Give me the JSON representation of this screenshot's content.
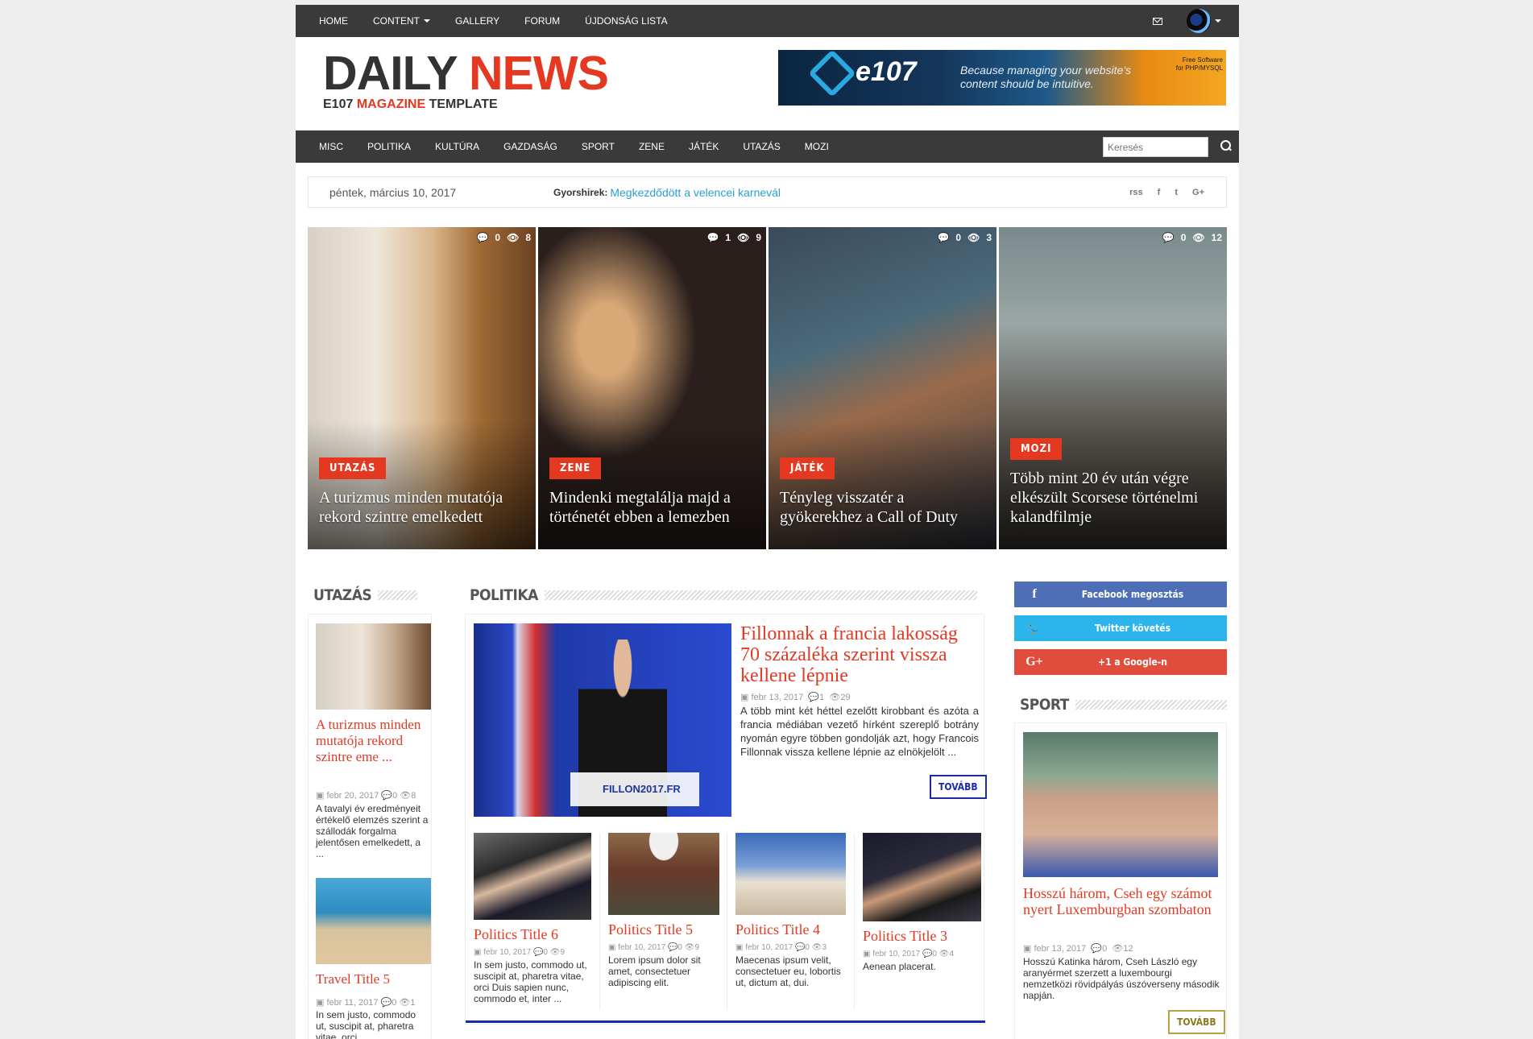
{
  "topnav": {
    "items": [
      "HOME",
      "CONTENT",
      "GALLERY",
      "FORUM",
      "ÚJDONSÁG LISTA"
    ]
  },
  "logo": {
    "word1": "DAILY",
    "word2": "NEWS",
    "sub1": "E107",
    "sub2": "MAGAZINE",
    "sub3": "TEMPLATE"
  },
  "banner": {
    "logo_text": "e107",
    "tagline1": "Because managing your website's",
    "tagline2": "content should be intuitive.",
    "fs1": "Free Software",
    "fs2": "for PHP/MYSQL"
  },
  "catnav": {
    "items": [
      "MISC",
      "POLITIKA",
      "KULTÚRA",
      "GAZDASÁG",
      "SPORT",
      "ZENE",
      "JÁTÉK",
      "UTAZÁS",
      "MOZI"
    ],
    "search_placeholder": "Keresés"
  },
  "infobar": {
    "date": "péntek, március 10, 2017",
    "breaking_label": "Gyorshirek:",
    "breaking_text": "Megkezdődött a velencei karnevál",
    "social": [
      "rss",
      "f",
      "t",
      "G+"
    ]
  },
  "featured": [
    {
      "badge": "UTAZÁS",
      "title": "A turizmus minden mutatója rekord szintre emelkedett",
      "comments": "0",
      "views": "8"
    },
    {
      "badge": "ZENE",
      "title": "Mindenki megtalálja majd a történetét ebben a lemezben",
      "comments": "1",
      "views": "9"
    },
    {
      "badge": "JÁTÉK",
      "title": "Tényleg visszatér a gyökerekhez a Call of Duty",
      "comments": "0",
      "views": "3"
    },
    {
      "badge": "MOZI",
      "title": "Több mint 20 év után végre elkészült Scorsese történelmi kalandfilmje",
      "comments": "0",
      "views": "12"
    }
  ],
  "utazas": {
    "heading": "UTAZÁS",
    "items": [
      {
        "title": "A turizmus minden mutatója rekord szintre eme ...",
        "date": "febr 20, 2017",
        "comments": "0",
        "views": "8",
        "excerpt": "A tavalyi év eredményeit értékelő elemzés szerint a szállodák forgalma jelentősen emelkedett, a ..."
      },
      {
        "title": "Travel Title 5",
        "date": "febr 11, 2017",
        "comments": "0",
        "views": "1",
        "excerpt": "In sem justo, commodo ut, suscipit at, pharetra vitae, orci."
      }
    ]
  },
  "politika": {
    "heading": "POLITIKA",
    "main": {
      "title": "Fillonnak a francia lakosság 70 százaléka szerint vissza kellene lépnie",
      "date": "febr 13, 2017",
      "comments": "1",
      "views": "29",
      "excerpt": "A több mint két héttel ezelőtt kirobbant és azóta a francia médiában vezető hírként szereplő botrány nyomán egyre többen gondolják azt, hogy Francois Fillonnak vissza kellene lépnie az elnökjelölt ...",
      "podium": "FILLON2017.FR",
      "more": "TOVÁBB"
    },
    "grid": [
      {
        "title": "Politics Title 6",
        "date": "febr 10, 2017",
        "comments": "0",
        "views": "9",
        "excerpt": "In sem justo, commodo ut, suscipit at, pharetra vitae, orci Duis sapien nunc, commodo et, inter ..."
      },
      {
        "title": "Politics Title 5",
        "date": "febr 10, 2017",
        "comments": "0",
        "views": "9",
        "excerpt": "Lorem ipsum dolor sit amet, consectetuer adipiscing elit."
      },
      {
        "title": "Politics Title 4",
        "date": "febr 10, 2017",
        "comments": "0",
        "views": "3",
        "excerpt": "Maecenas ipsum velit, consectetuer eu, lobortis ut, dictum at, dui."
      },
      {
        "title": "Politics Title 3",
        "date": "febr 10, 2017",
        "comments": "0",
        "views": "4",
        "excerpt": "Aenean placerat."
      }
    ]
  },
  "social_buttons": {
    "facebook": "Facebook megosztás",
    "twitter": "Twitter követés",
    "google": "+1 a Google-n"
  },
  "sport": {
    "heading": "SPORT",
    "title": "Hosszú három, Cseh egy számot nyert Luxemburgban szombaton",
    "date": "febr 13, 2017",
    "comments": "0",
    "views": "12",
    "excerpt": "Hosszú Katinka három, Cseh László egy aranyérmet szerzett a luxembourgi nemzetközi rövidpályás úszóverseny második napján.",
    "more": "TOVÁBB"
  },
  "colors": {
    "accent": "#e43821",
    "nav": "#3a3a3a",
    "link": "#2a9fd6",
    "button_border": "#1a2aa8"
  }
}
